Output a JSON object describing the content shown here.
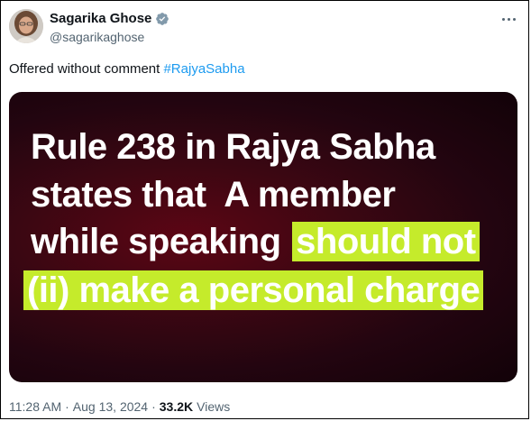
{
  "author": {
    "name": "Sagarika Ghose",
    "handle": "@sagarikaghose",
    "verified": true
  },
  "tweet": {
    "text": "Offered without comment ",
    "hashtag": "#RajyaSabha"
  },
  "media": {
    "lines": [
      {
        "text": "Rule 238 in Rajya Sabha",
        "highlight": ""
      },
      {
        "text": "states that  A member",
        "highlight": ""
      },
      {
        "text": "while speaking ",
        "highlight": "should not"
      },
      {
        "text": "",
        "highlight": "(ii) make a personal charge"
      }
    ],
    "background_color": "#3c0712",
    "highlight_color": "#c5eb2b"
  },
  "meta": {
    "time": "11:28 AM",
    "separator": "·",
    "date": "Aug 13, 2024",
    "views_count": "33.2K",
    "views_label": "Views"
  },
  "icons": {
    "verified": "verified-badge-icon",
    "more": "more-options-icon"
  }
}
